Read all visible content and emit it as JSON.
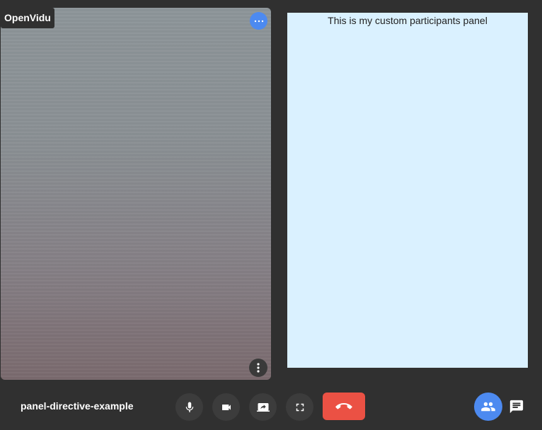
{
  "video": {
    "nickname": "OpenVidu"
  },
  "panel": {
    "title": "This is my custom participants panel"
  },
  "toolbar": {
    "session_name": "panel-directive-example",
    "buttons": [
      {
        "icon": "microphone-icon"
      },
      {
        "icon": "camera-icon"
      },
      {
        "icon": "screen-share-icon"
      },
      {
        "icon": "fullscreen-icon"
      },
      {
        "icon": "call-end-icon"
      },
      {
        "icon": "participants-icon"
      },
      {
        "icon": "chat-icon"
      }
    ]
  },
  "colors": {
    "background": "#303030",
    "accent": "#4d8af0",
    "leave": "#eb5144",
    "panel": "#daf1ff"
  }
}
